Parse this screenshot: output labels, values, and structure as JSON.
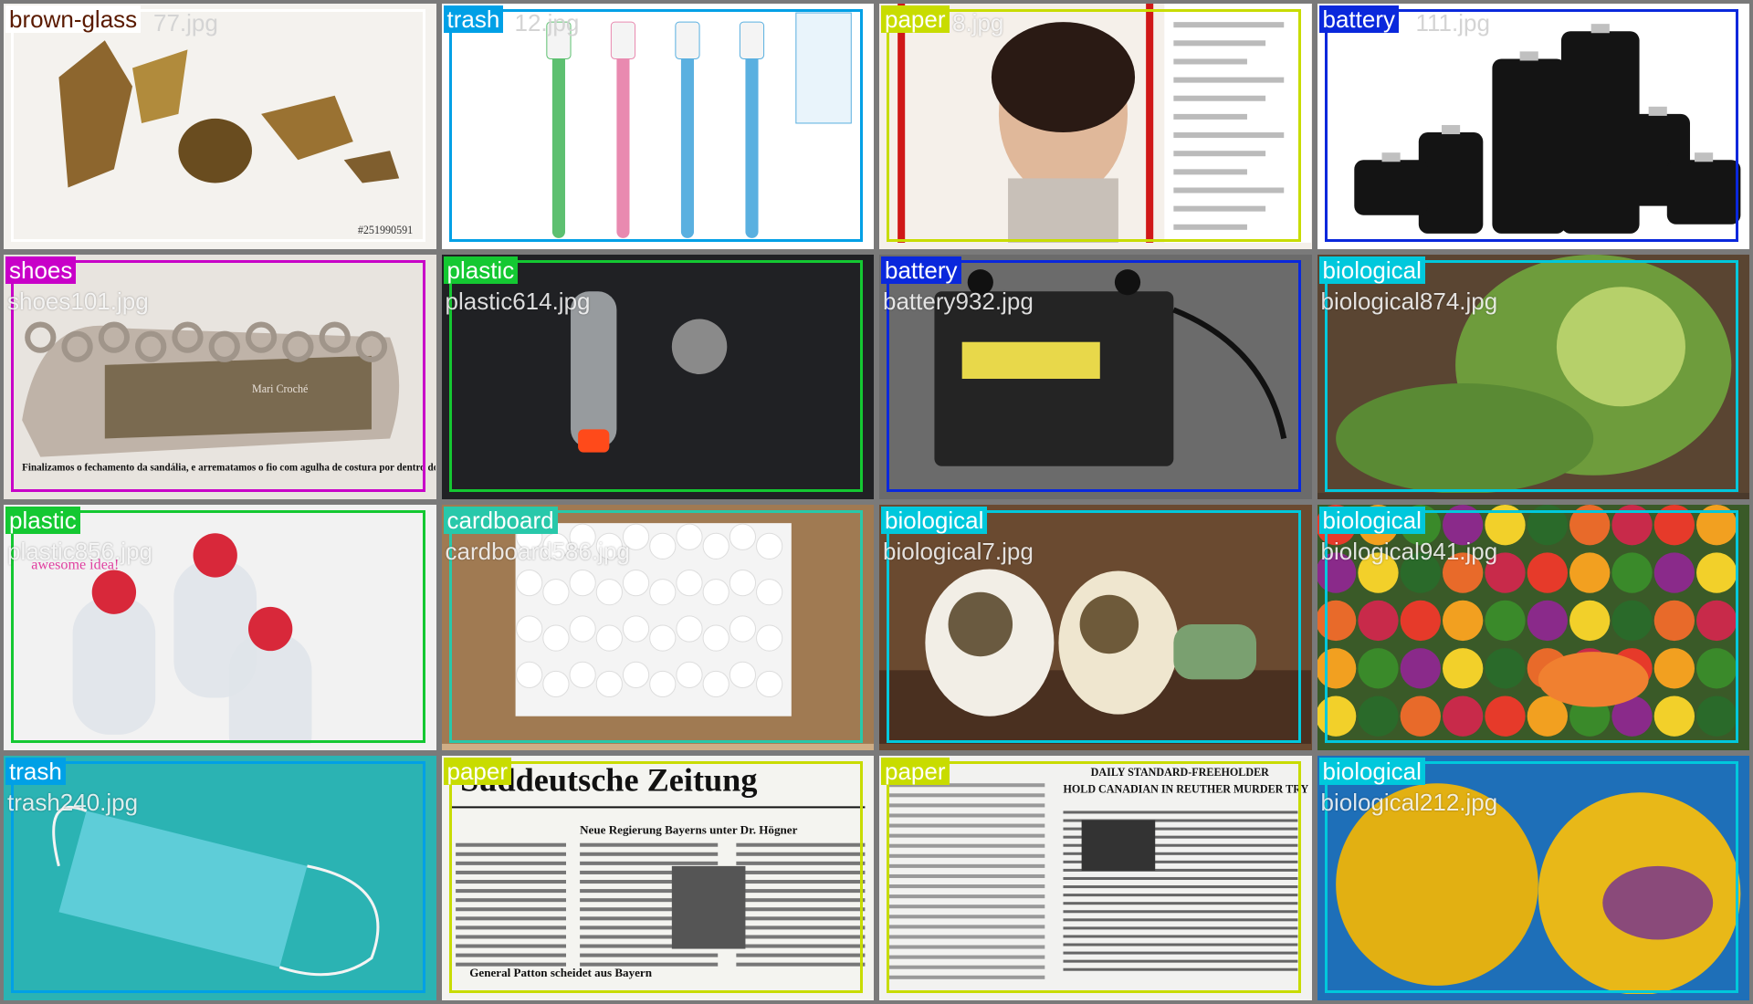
{
  "grid": {
    "columns": 4,
    "rows": 4,
    "tiles": [
      {
        "label": "brown-glass",
        "filename": "77.jpg",
        "color": "#ffffff",
        "text_color": "#5a1a00",
        "scene": "brown-glass",
        "bg": "#f4f2ee"
      },
      {
        "label": "trash",
        "filename": "12.jpg",
        "color": "#00a0e6",
        "text_color": "#ffffff",
        "scene": "toothbrush",
        "bg": "#ffffff"
      },
      {
        "label": "paper",
        "filename": "8.jpg",
        "color": "#c8dc00",
        "text_color": "#ffffff",
        "scene": "magazine",
        "bg": "#f5f0ea"
      },
      {
        "label": "battery",
        "filename": "111.jpg",
        "color": "#0a28dc",
        "text_color": "#ffffff",
        "scene": "cells",
        "bg": "#ffffff"
      },
      {
        "label": "shoes",
        "filename": "shoes101.jpg",
        "color": "#c800c8",
        "text_color": "#ffffff",
        "scene": "crochet",
        "bg": "#e8e4df",
        "caption": "Mari Croché",
        "subcaption": "Finalizamos o fechamento da sandália, e arrematamos o fio com agulha de costura por dentro dos pontos altos, pela parte de trás."
      },
      {
        "label": "plastic",
        "filename": "plastic614.jpg",
        "color": "#14c832",
        "text_color": "#ffffff",
        "scene": "bottle-dark",
        "bg": "#202124"
      },
      {
        "label": "battery",
        "filename": "battery932.jpg",
        "color": "#0a28dc",
        "text_color": "#ffffff",
        "scene": "car-battery",
        "bg": "#6b6b6b"
      },
      {
        "label": "biological",
        "filename": "biological874.jpg",
        "color": "#00c8dc",
        "text_color": "#ffffff",
        "scene": "cabbage",
        "bg": "#4a3a2c"
      },
      {
        "label": "plastic",
        "filename": "plastic856.jpg",
        "color": "#14c832",
        "text_color": "#ffffff",
        "scene": "bottles-white",
        "bg": "#f2f2f2",
        "caption": "awesome idea!"
      },
      {
        "label": "cardboard",
        "filename": "cardboard586.jpg",
        "color": "#28c8aa",
        "text_color": "#ffffff",
        "scene": "box",
        "bg": "#cfae86"
      },
      {
        "label": "biological",
        "filename": "biological7.jpg",
        "color": "#00c8dc",
        "text_color": "#ffffff",
        "scene": "radish",
        "bg": "#6a4a30"
      },
      {
        "label": "biological",
        "filename": "biological941.jpg",
        "color": "#00c8dc",
        "text_color": "#ffffff",
        "scene": "veggies",
        "bg": "#3a5a28"
      },
      {
        "label": "trash",
        "filename": "trash240.jpg",
        "color": "#00a0e6",
        "text_color": "#ffffff",
        "scene": "mask",
        "bg": "#2bb3b3"
      },
      {
        "label": "paper",
        "filename": "",
        "color": "#c8dc00",
        "text_color": "#ffffff",
        "scene": "newspaper-de",
        "bg": "#f4f4f0",
        "caption": "Süddeutsche Zeitung",
        "subcaption": "Neue Regierung Bayerns unter Dr. Högner",
        "footer": "General Patton scheidet aus Bayern"
      },
      {
        "label": "paper",
        "filename": "",
        "color": "#c8dc00",
        "text_color": "#ffffff",
        "scene": "newspaper-ca",
        "bg": "#f2f2f0",
        "caption": "DAILY STANDARD-FREEHOLDER",
        "subcaption": "HOLD CANADIAN IN REUTHER MURDER TRY"
      },
      {
        "label": "biological",
        "filename": "biological212.jpg",
        "color": "#00c8dc",
        "text_color": "#ffffff",
        "scene": "grapefruit",
        "bg": "#1e6fb8"
      }
    ]
  },
  "palette": {
    "grid_background": "#7a7a7a"
  }
}
